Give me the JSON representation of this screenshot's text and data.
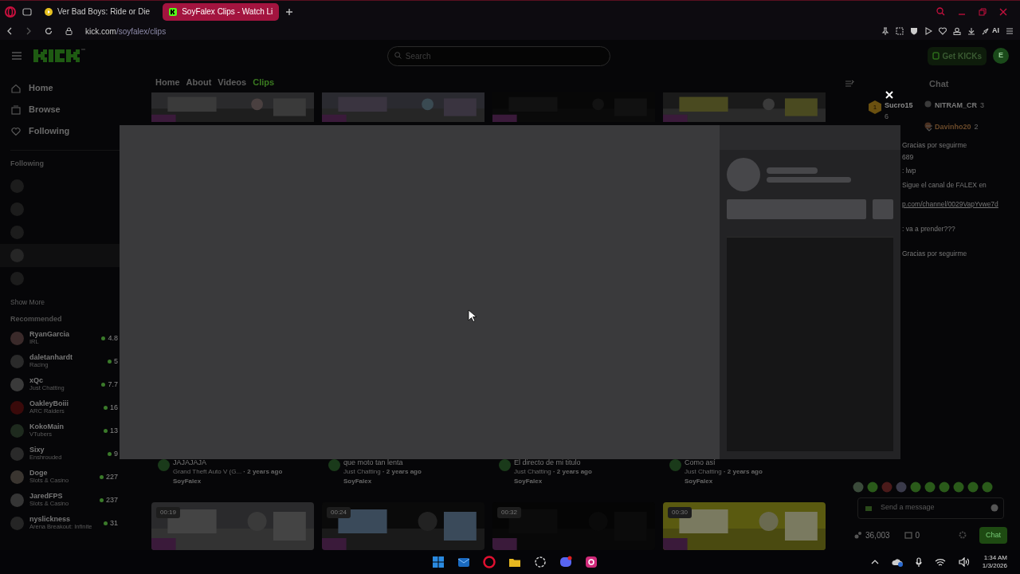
{
  "browser": {
    "tabs": [
      {
        "label": "Ver Bad Boys: Ride or Die",
        "selected": false
      },
      {
        "label": "SoyFalex Clips - Watch Li",
        "selected": true
      }
    ],
    "url": {
      "host": "kick.com",
      "path": "/soyfalex/clips"
    },
    "ai_label": "AI"
  },
  "header": {
    "search": {
      "placeholder": "Search"
    },
    "get_kicks": "Get KICKs",
    "avatar_initial": "E"
  },
  "sidebar": {
    "nav": [
      {
        "label": "Home",
        "kind": "home"
      },
      {
        "label": "Browse",
        "kind": "browse"
      },
      {
        "label": "Following",
        "kind": "heart"
      }
    ],
    "following_title": "Following",
    "following": [
      {
        "selected": false
      },
      {
        "selected": false
      },
      {
        "selected": false
      },
      {
        "selected": true
      },
      {
        "selected": false
      }
    ],
    "show_more": "Show More",
    "recommended_title": "Recommended",
    "recommended": [
      {
        "name": "RyanGarcia",
        "category": "IRL",
        "viewers": "4.8"
      },
      {
        "name": "daletanhardt",
        "category": "Racing",
        "viewers": "5"
      },
      {
        "name": "xQc",
        "category": "Just Chatting",
        "viewers": "7.7"
      },
      {
        "name": "OakleyBoiii",
        "category": "ARC Raiders",
        "viewers": "16"
      },
      {
        "name": "KokoMain",
        "category": "VTubers",
        "viewers": "13"
      },
      {
        "name": "Sixy",
        "category": "Enshrouded",
        "viewers": "9"
      },
      {
        "name": "Doge",
        "category": "Slots & Casino",
        "viewers": "227"
      },
      {
        "name": "JaredFPS",
        "category": "Slots & Casino",
        "viewers": "237"
      },
      {
        "name": "nyslickness",
        "category": "Arena Breakout: Infinite",
        "viewers": "31"
      }
    ]
  },
  "channel_tabs": [
    {
      "label": "Home",
      "selected": false
    },
    {
      "label": "About",
      "selected": false
    },
    {
      "label": "Videos",
      "selected": false
    },
    {
      "label": "Clips",
      "selected": true
    }
  ],
  "clips": [
    {
      "title": "JAJAJAJA",
      "category": "Grand Theft Auto V (G...",
      "age": "· 2 years ago",
      "channel": "SoyFalex"
    },
    {
      "title": "que moto tan lenta",
      "category": "Just Chatting",
      "age": "· 2 years ago",
      "channel": "SoyFalex"
    },
    {
      "title": "El directo de mi titulo",
      "category": "Just Chatting",
      "age": "· 2 years ago",
      "channel": "SoyFalex"
    },
    {
      "title": "Como así",
      "category": "Just Chatting",
      "age": "· 2 years ago",
      "channel": "SoyFalex"
    }
  ],
  "next_clips": [
    {
      "duration": "00:19"
    },
    {
      "duration": "00:24"
    },
    {
      "duration": "00:32"
    },
    {
      "duration": "00:30"
    }
  ],
  "chat": {
    "title": "Chat",
    "gifters": [
      {
        "name": "Sucro15",
        "count": "6",
        "badge": "1",
        "color": "#8a8a8a"
      },
      {
        "name": "NITRAM_CR",
        "count": "3",
        "color": "#7a7a7a"
      },
      {
        "name": "Davinho20",
        "count": "2",
        "color": "#6b4a2a"
      }
    ],
    "messages": [
      {
        "kind": "text",
        "text": "Gracias por seguirme"
      },
      {
        "kind": "text",
        "text": "689"
      },
      {
        "kind": "text",
        "text": ": lwp"
      },
      {
        "kind": "text",
        "text": "Sigue el canal de FALEX en"
      },
      {
        "kind": "link",
        "text": "p.com/channel/0029VapYvwe7d"
      },
      {
        "kind": "text",
        "text": ": va a prender???"
      },
      {
        "kind": "text",
        "text": "Gracias por seguirme"
      }
    ],
    "input": {
      "placeholder": "Send a message"
    },
    "points": "36,003",
    "gifts": "0",
    "send": "Chat"
  },
  "taskbar": {
    "time": "1:34 AM",
    "date": "1/3/2026"
  }
}
